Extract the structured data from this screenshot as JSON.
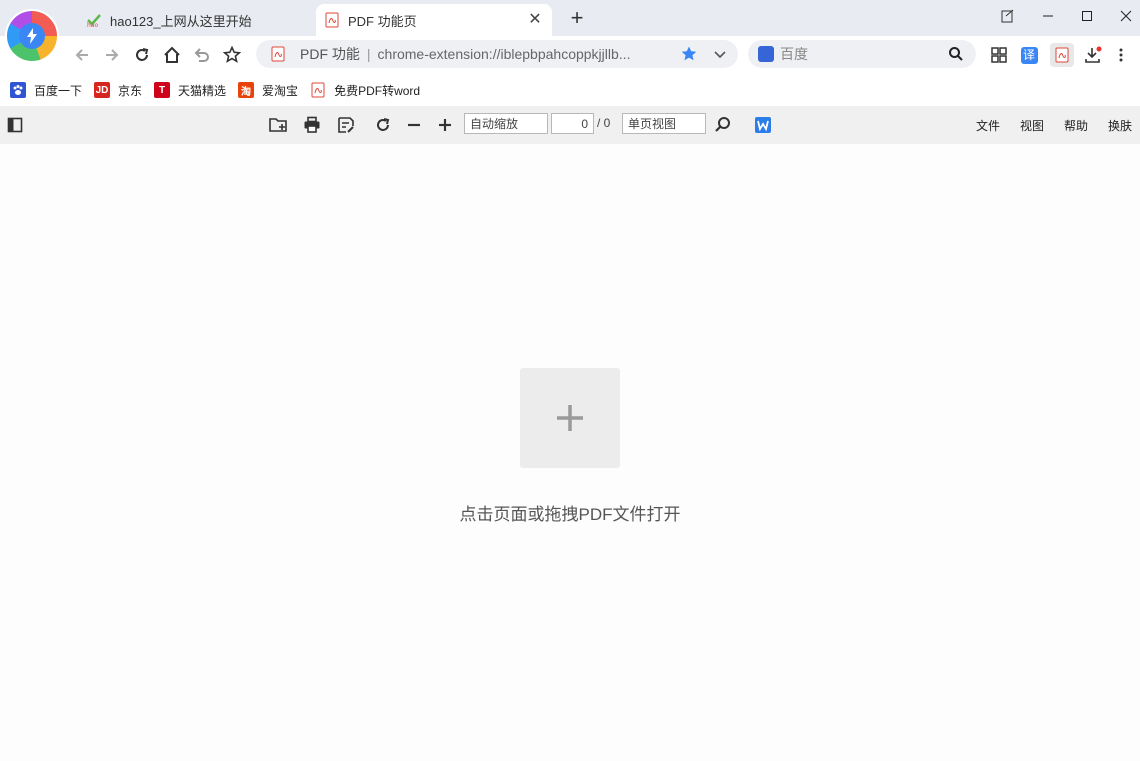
{
  "browser": {
    "tabs": [
      {
        "title": "hao123_上网从这里开始",
        "favicon": "hao123-icon"
      },
      {
        "title": "PDF 功能页",
        "favicon": "pdf-icon",
        "active": true
      }
    ],
    "new_tab": "+"
  },
  "address": {
    "label": "PDF 功能",
    "separator": "|",
    "url": "chrome-extension://iblepbpahcoppkjjllb..."
  },
  "search": {
    "placeholder": "百度"
  },
  "extensions": {
    "translate": "译"
  },
  "bookmarks": [
    {
      "label": "百度一下",
      "icon": "baidu-icon",
      "color": "#2f54d4"
    },
    {
      "label": "京东",
      "icon": "jd-icon",
      "badge": "JD",
      "color": "#d7261e"
    },
    {
      "label": "天猫精选",
      "icon": "tmall-icon",
      "badge": "T",
      "color": "#d0021b"
    },
    {
      "label": "爱淘宝",
      "icon": "taobao-icon",
      "badge": "淘",
      "color": "#e8430b"
    },
    {
      "label": "免费PDF转word",
      "icon": "pdf-icon",
      "color": "#e0453a"
    }
  ],
  "pdf_toolbar": {
    "zoom": "自动缩放",
    "page_current": "0",
    "page_total": "/ 0",
    "view_mode": "单页视图",
    "menus": [
      "文件",
      "视图",
      "帮助",
      "换肤"
    ]
  },
  "main": {
    "hint": "点击页面或拖拽PDF文件打开"
  },
  "colors": {
    "accent": "#3a86f5",
    "tab_strip": "#e8ebf2",
    "pdf_toolbar": "#f0f0f1"
  }
}
